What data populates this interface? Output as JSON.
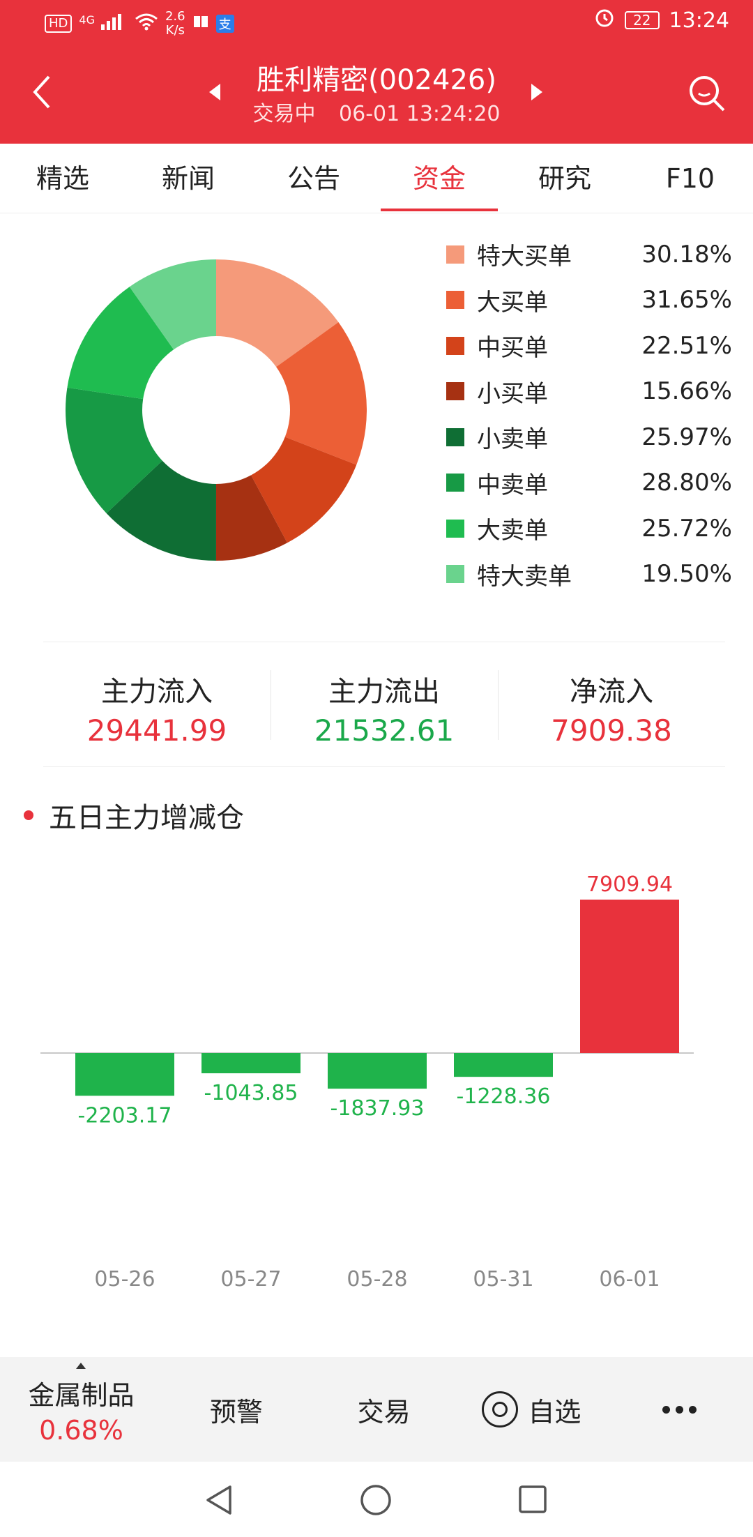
{
  "status": {
    "left_badges": [
      "HD",
      "4G"
    ],
    "speed_top": "2.6",
    "speed_bottom": "K/s",
    "pay_badge": "支",
    "battery": "22",
    "time": "13:24"
  },
  "nav": {
    "title": "胜利精密(002426)",
    "state": "交易中",
    "datetime": "06-01 13:24:20"
  },
  "tabs": [
    {
      "label": "精选"
    },
    {
      "label": "新闻"
    },
    {
      "label": "公告"
    },
    {
      "label": "资金",
      "active": true
    },
    {
      "label": "研究"
    },
    {
      "label": "F10"
    }
  ],
  "legend": [
    {
      "label": "特大买单",
      "value": "30.18%",
      "color": "#f59a7a"
    },
    {
      "label": "大买单",
      "value": "31.65%",
      "color": "#ec5f36"
    },
    {
      "label": "中买单",
      "value": "22.51%",
      "color": "#d3431a"
    },
    {
      "label": "小买单",
      "value": "15.66%",
      "color": "#a63112"
    },
    {
      "label": "小卖单",
      "value": "25.97%",
      "color": "#0f6e34"
    },
    {
      "label": "中卖单",
      "value": "28.80%",
      "color": "#179a45"
    },
    {
      "label": "大卖单",
      "value": "25.72%",
      "color": "#1fbc50"
    },
    {
      "label": "特大卖单",
      "value": "19.50%",
      "color": "#6ad38d"
    }
  ],
  "flow": {
    "inflow_label": "主力流入",
    "inflow_value": "29441.99",
    "outflow_label": "主力流出",
    "outflow_value": "21532.61",
    "net_label": "净流入",
    "net_value": "7909.38"
  },
  "section": {
    "title": "五日主力增减仓"
  },
  "chart_data": [
    {
      "type": "pie",
      "categories": [
        "特大买单",
        "大买单",
        "中买单",
        "小买单",
        "小卖单",
        "中卖单",
        "大卖单",
        "特大卖单"
      ],
      "values": [
        15.09,
        15.825,
        11.255,
        7.83,
        12.985,
        14.4,
        12.86,
        9.75
      ],
      "colors": [
        "#f59a7a",
        "#ec5f36",
        "#d3431a",
        "#a63112",
        "#0f6e34",
        "#179a45",
        "#1fbc50",
        "#6ad38d"
      ]
    },
    {
      "type": "bar",
      "categories": [
        "05-26",
        "05-27",
        "05-28",
        "05-31",
        "06-01"
      ],
      "values": [
        -2203.17,
        -1043.85,
        -1837.93,
        -1228.36,
        7909.94
      ],
      "labels": [
        "-2203.17",
        "-1043.85",
        "-1837.93",
        "-1228.36",
        "7909.94"
      ],
      "positive_color": "#e8323c",
      "negative_color": "#1fb34b"
    }
  ],
  "bottom": {
    "sector_name": "金属制品",
    "sector_change": "0.68%",
    "alert": "预警",
    "trade": "交易",
    "favorite": "自选"
  }
}
